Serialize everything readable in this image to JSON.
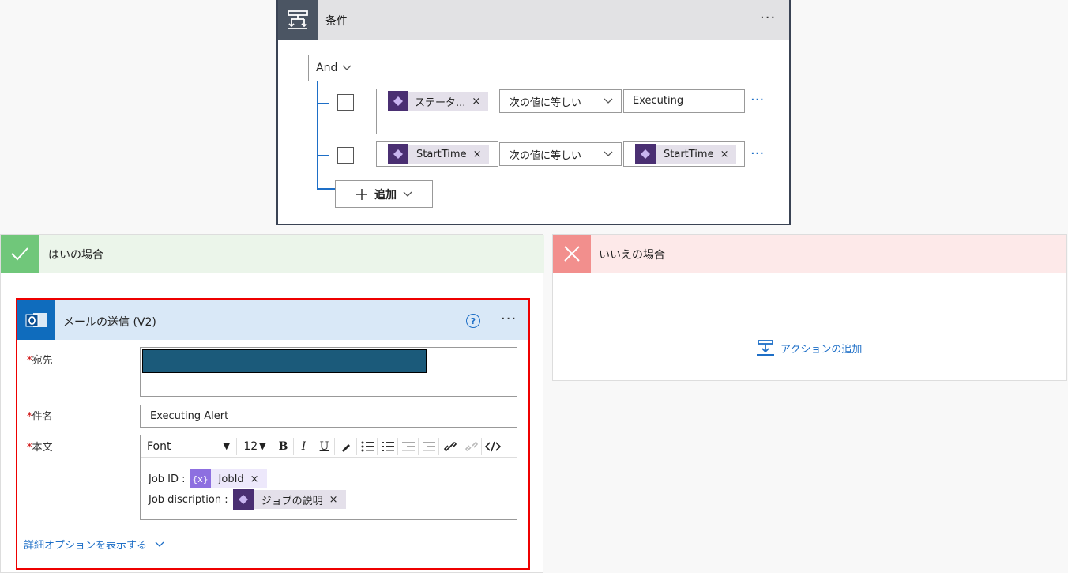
{
  "condition": {
    "title": "条件",
    "logic_operator": "And",
    "rows": [
      {
        "left_token": "ステータ...",
        "operator": "次の値に等しい",
        "right_value": "Executing"
      },
      {
        "left_token": "StartTime",
        "operator": "次の値に等しい",
        "right_token": "StartTime"
      }
    ],
    "add_label": "追加"
  },
  "yes_branch": {
    "title": "はいの場合"
  },
  "no_branch": {
    "title": "いいえの場合",
    "add_action_label": "アクションの追加"
  },
  "send_mail": {
    "title": "メールの送信 (V2)",
    "help": "?",
    "to_label": "宛先",
    "subject_label": "件名",
    "subject_value": "Executing Alert",
    "body_label": "本文",
    "toolbar": {
      "font": "Font",
      "size": "12"
    },
    "body": {
      "line1_label": "Job ID :",
      "line1_token": "JobId",
      "line2_label": "Job discription :",
      "line2_token": "ジョブの説明"
    },
    "more_options": "詳細オプションを表示する"
  },
  "colors": {
    "accent": "#1e6fc7",
    "highlight": "#e00000",
    "yes": "#70c77a",
    "no": "#f28f8d"
  }
}
